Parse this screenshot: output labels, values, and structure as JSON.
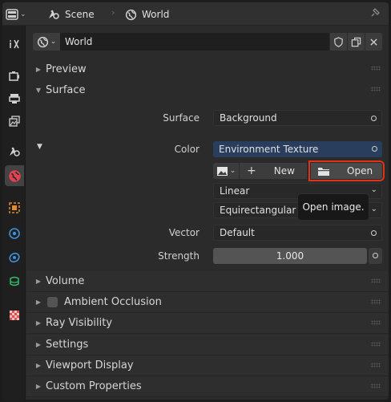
{
  "header": {
    "scene_label": "Scene",
    "world_label": "World"
  },
  "world_block": {
    "name": "World"
  },
  "panels": {
    "preview": "Preview",
    "surface": "Surface",
    "volume": "Volume",
    "ambient_occlusion": "Ambient Occlusion",
    "ray_visibility": "Ray Visibility",
    "settings": "Settings",
    "viewport_display": "Viewport Display",
    "custom_properties": "Custom Properties"
  },
  "surface": {
    "surface_label": "Surface",
    "surface_value": "Background",
    "color_label": "Color",
    "color_value": "Environment Texture",
    "new_label": "New",
    "open_label": "Open",
    "interpolation_value": "Linear",
    "projection_value": "Equirectangular",
    "vector_label": "Vector",
    "vector_value": "Default",
    "strength_label": "Strength",
    "strength_value": "1.000"
  },
  "tooltip": {
    "text": "Open image."
  },
  "colors": {
    "accent_blue": "#283e5c",
    "highlight_red": "#e0331a",
    "world_icon": "#e0434f"
  },
  "icons": [
    "editor-type-icon",
    "scene-icon",
    "world-icon",
    "pin-icon",
    "tool-icon",
    "render-icon",
    "output-icon",
    "view-layer-icon",
    "scene-tab-icon",
    "world-tab-icon",
    "object-icon",
    "physics-icon",
    "constraints-icon",
    "data-icon",
    "texture-icon",
    "shield-icon",
    "copy-icon",
    "close-icon",
    "image-icon",
    "folder-icon"
  ]
}
